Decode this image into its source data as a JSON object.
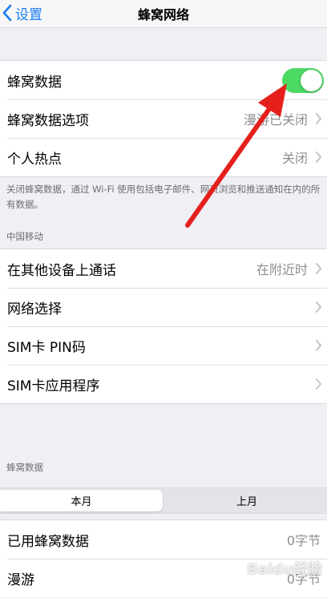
{
  "nav": {
    "back_label": "设置",
    "title": "蜂窝网络"
  },
  "group1": {
    "cellular_data": {
      "label": "蜂窝数据",
      "enabled": true
    },
    "cellular_options": {
      "label": "蜂窝数据选项",
      "value": "漫游已关闭"
    },
    "hotspot": {
      "label": "个人热点",
      "value": "关闭"
    }
  },
  "footnote": "关闭蜂窝数据，通过 Wi-Fi 使用包括电子邮件、网页浏览和推送通知在内的所有数据。",
  "carrier": {
    "header": "中国移动"
  },
  "group2": {
    "other_devices": {
      "label": "在其他设备上通话",
      "value": "在附近时"
    },
    "network_select": {
      "label": "网络选择"
    },
    "sim_pin": {
      "label": "SIM卡 PIN码"
    },
    "sim_apps": {
      "label": "SIM卡应用程序"
    }
  },
  "usage": {
    "header": "蜂窝数据",
    "segments": {
      "this_month": "本月",
      "last_month": "上月"
    },
    "used": {
      "label": "已用蜂窝数据",
      "value": "0字节"
    },
    "roaming": {
      "label": "漫游",
      "value": "0字节"
    }
  },
  "colors": {
    "accent": "#1a7cf5",
    "toggle_on": "#4cd964",
    "arrow": "#e5201c"
  },
  "watermark": "Baidu经验"
}
